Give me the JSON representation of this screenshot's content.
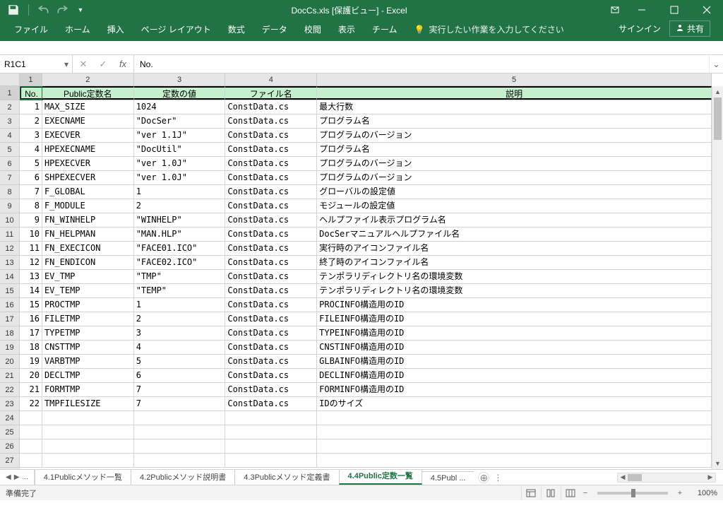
{
  "title": "DocCs.xls  [保護ビュー] - Excel",
  "qat": {
    "undo_tip": "元に戻す",
    "redo_tip": "やり直し"
  },
  "ribbon": {
    "tabs": [
      "ファイル",
      "ホーム",
      "挿入",
      "ページ レイアウト",
      "数式",
      "データ",
      "校閲",
      "表示",
      "チーム"
    ],
    "tell_me": "実行したい作業を入力してください",
    "signin": "サインイン",
    "share": "共有"
  },
  "namebox": "R1C1",
  "formula": "No.",
  "col_headers": [
    "1",
    "2",
    "3",
    "4",
    "5"
  ],
  "row_headers": [
    "1",
    "2",
    "3",
    "4",
    "5",
    "6",
    "7",
    "8",
    "9",
    "10",
    "11",
    "12",
    "13",
    "14",
    "15",
    "16",
    "17",
    "18",
    "19",
    "20",
    "21",
    "22",
    "23",
    "24",
    "25",
    "26",
    "27"
  ],
  "table": {
    "headers": [
      "No.",
      "Public定数名",
      "定数の値",
      "ファイル名",
      "説明"
    ],
    "rows": [
      [
        "1",
        "MAX_SIZE",
        "1024",
        "ConstData.cs",
        "最大行数"
      ],
      [
        "2",
        "EXECNAME",
        "\"DocSer\"",
        "ConstData.cs",
        "プログラム名"
      ],
      [
        "3",
        "EXECVER",
        "\"ver 1.1J\"",
        "ConstData.cs",
        "プログラムのバージョン"
      ],
      [
        "4",
        "HPEXECNAME",
        "\"DocUtil\"",
        "ConstData.cs",
        "プログラム名"
      ],
      [
        "5",
        "HPEXECVER",
        "\"ver 1.0J\"",
        "ConstData.cs",
        "プログラムのバージョン"
      ],
      [
        "6",
        "SHPEXECVER",
        "\"ver 1.0J\"",
        "ConstData.cs",
        "プログラムのバージョン"
      ],
      [
        "7",
        "F_GLOBAL",
        "1",
        "ConstData.cs",
        "グローバルの設定値"
      ],
      [
        "8",
        "F_MODULE",
        "2",
        "ConstData.cs",
        "モジュールの設定値"
      ],
      [
        "9",
        "FN_WINHELP",
        "\"WINHELP\"",
        "ConstData.cs",
        "ヘルプファイル表示プログラム名"
      ],
      [
        "10",
        "FN_HELPMAN",
        "\"MAN.HLP\"",
        "ConstData.cs",
        "DocSerマニュアルヘルプファイル名"
      ],
      [
        "11",
        "FN_EXECICON",
        "\"FACE01.ICO\"",
        "ConstData.cs",
        "実行時のアイコンファイル名"
      ],
      [
        "12",
        "FN_ENDICON",
        "\"FACE02.ICO\"",
        "ConstData.cs",
        "終了時のアイコンファイル名"
      ],
      [
        "13",
        "EV_TMP",
        "\"TMP\"",
        "ConstData.cs",
        "テンポラリディレクトリ名の環境変数"
      ],
      [
        "14",
        "EV_TEMP",
        "\"TEMP\"",
        "ConstData.cs",
        "テンポラリディレクトリ名の環境変数"
      ],
      [
        "15",
        "PROCTMP",
        "1",
        "ConstData.cs",
        "PROCINFO構造用のID"
      ],
      [
        "16",
        "FILETMP",
        "2",
        "ConstData.cs",
        "FILEINFO構造用のID"
      ],
      [
        "17",
        "TYPETMP",
        "3",
        "ConstData.cs",
        "TYPEINFO構造用のID"
      ],
      [
        "18",
        "CNSTTMP",
        "4",
        "ConstData.cs",
        "CNSTINFO構造用のID"
      ],
      [
        "19",
        "VARBTMP",
        "5",
        "ConstData.cs",
        "GLBAINFO構造用のID"
      ],
      [
        "20",
        "DECLTMP",
        "6",
        "ConstData.cs",
        "DECLINFO構造用のID"
      ],
      [
        "21",
        "FORMTMP",
        "7",
        "ConstData.cs",
        "FORMINFO構造用のID"
      ],
      [
        "22",
        "TMPFILESIZE",
        "7",
        "ConstData.cs",
        "IDのサイズ"
      ]
    ]
  },
  "sheets": {
    "overflow": "...",
    "tabs": [
      "4.1Publicメソッド一覧",
      "4.2Publicメソッド説明書",
      "4.3Publicメソッド定義書",
      "4.4Public定数一覧",
      "4.5Publ ..."
    ],
    "active": 3
  },
  "status": {
    "ready": "準備完了",
    "zoom": "100%"
  }
}
